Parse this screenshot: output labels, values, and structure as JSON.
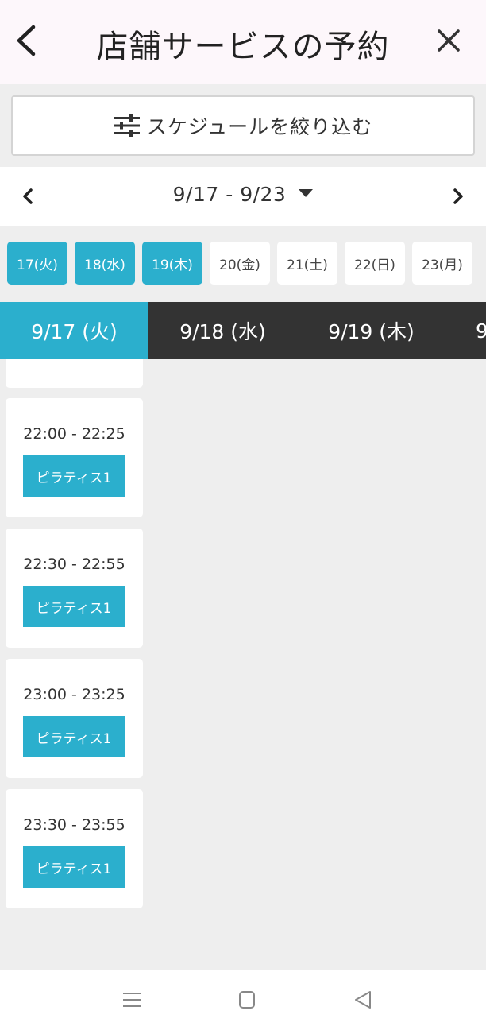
{
  "header": {
    "title": "店舗サービスの予約"
  },
  "filter": {
    "label": "スケジュールを絞り込む"
  },
  "week": {
    "range": "9/17 - 9/23"
  },
  "day_chips": [
    {
      "label": "17(火)",
      "active": true
    },
    {
      "label": "18(水)",
      "active": true
    },
    {
      "label": "19(木)",
      "active": true
    },
    {
      "label": "20(金)",
      "active": false
    },
    {
      "label": "21(土)",
      "active": false
    },
    {
      "label": "22(日)",
      "active": false
    },
    {
      "label": "23(月)",
      "active": false
    }
  ],
  "date_tabs": [
    {
      "label": "9/17 (火)",
      "active": true
    },
    {
      "label": "9/18 (水)",
      "active": false
    },
    {
      "label": "9/19 (木)",
      "active": false
    },
    {
      "label": "9",
      "active": false
    }
  ],
  "slots": [
    {
      "time": "22:00 - 22:25",
      "service": "ピラティス1"
    },
    {
      "time": "22:30 - 22:55",
      "service": "ピラティス1"
    },
    {
      "time": "23:00 - 23:25",
      "service": "ピラティス1"
    },
    {
      "time": "23:30 - 23:55",
      "service": "ピラティス1"
    }
  ],
  "colors": {
    "accent": "#2bafcd",
    "tabbar_bg": "#333333",
    "page_bg": "#eeeeee",
    "header_bg": "#fdf7fb"
  },
  "icons": {
    "back": "chevron-left-icon",
    "close": "close-icon",
    "filter": "sliders-icon",
    "prev_week": "chevron-left-icon",
    "next_week": "chevron-right-icon",
    "range_dropdown": "triangle-down-icon",
    "nav_menu": "menu-icon",
    "nav_home": "square-icon",
    "nav_back": "triangle-left-icon"
  }
}
